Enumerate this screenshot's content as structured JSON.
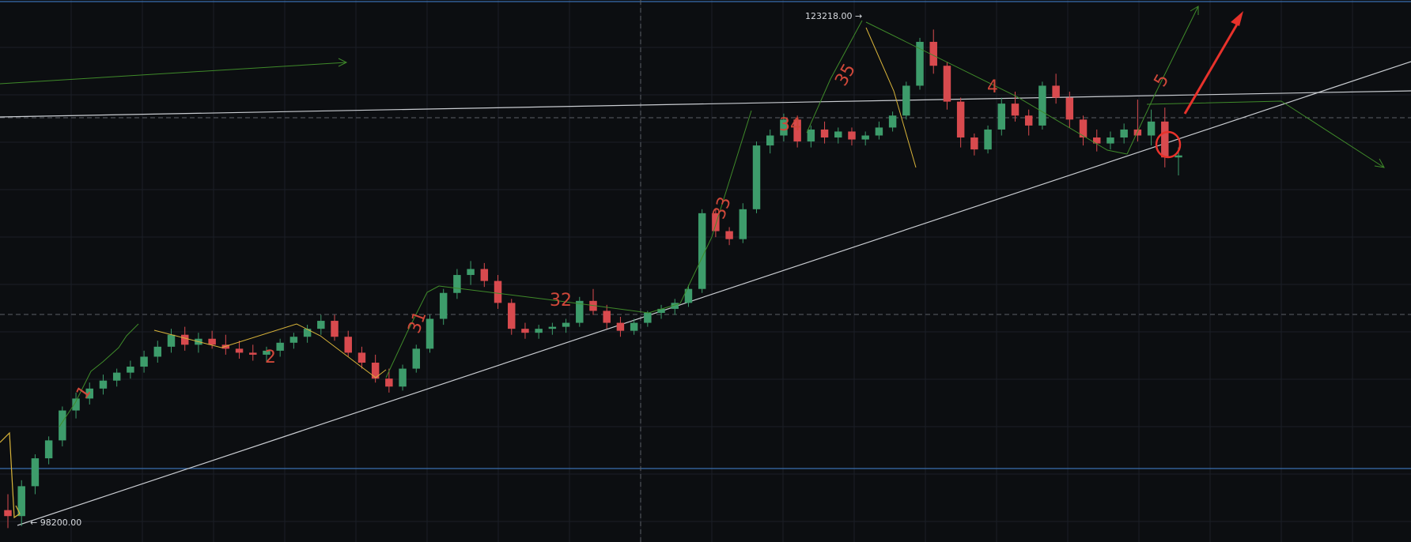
{
  "colors": {
    "background": "#0c0e11",
    "grid": "#1b1f26",
    "bull": "#3d9c6b",
    "bear": "#d84a4e",
    "horizontal_level": "#3a6fb0",
    "trendline": "#c9ccd1",
    "dashed_level": "#5c6066",
    "green_projection": "#3f8a2a",
    "yellow_wave": "#d9b43a",
    "red_arrow": "#e8322b",
    "wave_text": "#d0483a",
    "price_text": "#d8dbe0"
  },
  "chart_data": {
    "type": "candlestick",
    "title": "",
    "xlabel": "",
    "ylabel": "",
    "grid": true,
    "ylim": [
      97500,
      124700
    ],
    "price_markers": [
      {
        "value": 123218,
        "label": "123218.00",
        "marks": "high"
      },
      {
        "value": 98200,
        "label": "98200.00",
        "marks": "low"
      }
    ],
    "wave_labels": [
      "1",
      "2",
      "31",
      "32",
      "33",
      "34",
      "35",
      "4",
      "5"
    ],
    "horizontal_levels": [
      {
        "value": 124600,
        "style": "solid"
      },
      {
        "value": 101000,
        "style": "solid"
      },
      {
        "value": 118800,
        "style": "dashed"
      },
      {
        "value": 109100,
        "style": "dashed"
      }
    ],
    "candles_ohlc": [
      [
        99100,
        99900,
        98200,
        98800
      ],
      [
        98800,
        100600,
        98300,
        100300
      ],
      [
        100300,
        101900,
        99900,
        101700
      ],
      [
        101700,
        102800,
        101400,
        102600
      ],
      [
        102600,
        104300,
        102300,
        104100
      ],
      [
        104100,
        105000,
        103700,
        104700
      ],
      [
        104700,
        105500,
        104400,
        105200
      ],
      [
        105200,
        105900,
        104900,
        105600
      ],
      [
        105600,
        106200,
        105300,
        106000
      ],
      [
        106000,
        106600,
        105700,
        106300
      ],
      [
        106300,
        107100,
        106000,
        106800
      ],
      [
        106800,
        107600,
        106500,
        107300
      ],
      [
        107300,
        108200,
        107000,
        107900
      ],
      [
        107900,
        108300,
        107100,
        107400
      ],
      [
        107400,
        108000,
        107000,
        107700
      ],
      [
        107700,
        108100,
        107200,
        107400
      ],
      [
        107400,
        107900,
        106900,
        107200
      ],
      [
        107200,
        107600,
        106700,
        107000
      ],
      [
        107000,
        107400,
        106600,
        106900
      ],
      [
        106900,
        107300,
        106500,
        107100
      ],
      [
        107100,
        107700,
        106800,
        107500
      ],
      [
        107500,
        108000,
        107200,
        107800
      ],
      [
        107800,
        108400,
        107500,
        108200
      ],
      [
        108200,
        108900,
        107900,
        108600
      ],
      [
        108600,
        108900,
        107600,
        107800
      ],
      [
        107800,
        108100,
        106800,
        107000
      ],
      [
        107000,
        107300,
        106200,
        106500
      ],
      [
        106500,
        106900,
        105500,
        105700
      ],
      [
        105700,
        106200,
        105000,
        105300
      ],
      [
        105300,
        106400,
        105100,
        106200
      ],
      [
        106200,
        107400,
        106000,
        107200
      ],
      [
        107200,
        108900,
        107000,
        108700
      ],
      [
        108700,
        110200,
        108400,
        110000
      ],
      [
        110000,
        111200,
        109700,
        110900
      ],
      [
        110900,
        111600,
        110400,
        111200
      ],
      [
        111200,
        111500,
        110300,
        110600
      ],
      [
        110600,
        110900,
        109200,
        109500
      ],
      [
        109500,
        109700,
        107900,
        108200
      ],
      [
        108200,
        108500,
        107700,
        108000
      ],
      [
        108000,
        108400,
        107700,
        108200
      ],
      [
        108200,
        108500,
        107900,
        108300
      ],
      [
        108300,
        108700,
        108000,
        108500
      ],
      [
        108500,
        109800,
        108300,
        109600
      ],
      [
        109600,
        110200,
        108900,
        109100
      ],
      [
        109100,
        109400,
        108200,
        108500
      ],
      [
        108500,
        108800,
        107800,
        108100
      ],
      [
        108100,
        108700,
        107900,
        108500
      ],
      [
        108500,
        109100,
        108300,
        109000
      ],
      [
        109000,
        109400,
        108700,
        109200
      ],
      [
        109200,
        109700,
        108900,
        109500
      ],
      [
        109500,
        110400,
        109300,
        110200
      ],
      [
        110200,
        114200,
        110000,
        114000
      ],
      [
        114000,
        114200,
        112800,
        113100
      ],
      [
        113100,
        113300,
        112400,
        112700
      ],
      [
        112700,
        114500,
        112500,
        114200
      ],
      [
        114200,
        117600,
        114000,
        117400
      ],
      [
        117400,
        118200,
        117000,
        117900
      ],
      [
        117900,
        119000,
        117600,
        118700
      ],
      [
        118700,
        118900,
        117300,
        117600
      ],
      [
        117600,
        118400,
        117300,
        118200
      ],
      [
        118200,
        118600,
        117500,
        117800
      ],
      [
        117800,
        118300,
        117500,
        118100
      ],
      [
        118100,
        118300,
        117400,
        117700
      ],
      [
        117700,
        118100,
        117400,
        117900
      ],
      [
        117900,
        118600,
        117700,
        118300
      ],
      [
        118300,
        119100,
        118100,
        118900
      ],
      [
        118900,
        120600,
        118700,
        120400
      ],
      [
        120400,
        122800,
        120200,
        122600
      ],
      [
        122600,
        123218,
        121000,
        121400
      ],
      [
        121400,
        121600,
        119200,
        119600
      ],
      [
        119600,
        119800,
        117300,
        117800
      ],
      [
        117800,
        118000,
        116900,
        117200
      ],
      [
        117200,
        118400,
        117000,
        118200
      ],
      [
        118200,
        119800,
        117900,
        119500
      ],
      [
        119500,
        120100,
        118600,
        118900
      ],
      [
        118900,
        119200,
        117900,
        118400
      ],
      [
        118400,
        120600,
        118200,
        120400
      ],
      [
        120400,
        121000,
        119500,
        119800
      ],
      [
        119800,
        120100,
        118300,
        118700
      ],
      [
        118700,
        118900,
        117400,
        117800
      ],
      [
        117800,
        118200,
        117100,
        117500
      ],
      [
        117500,
        118100,
        117200,
        117800
      ],
      [
        117800,
        118500,
        117500,
        118200
      ],
      [
        118200,
        119700,
        117600,
        117900
      ],
      [
        117900,
        119200,
        117400,
        118600
      ],
      [
        118600,
        119300,
        116300,
        116800
      ],
      [
        116800,
        117300,
        115900,
        116900
      ]
    ]
  },
  "annotation_labels": {
    "wave_1": "1",
    "wave_2": "2",
    "wave_31": "31",
    "wave_32": "32",
    "wave_33": "33",
    "wave_34": "34",
    "wave_35": "35",
    "wave_4": "4",
    "wave_5": "5",
    "high_label": "123218.00 →",
    "low_label": "← 98200.00"
  }
}
